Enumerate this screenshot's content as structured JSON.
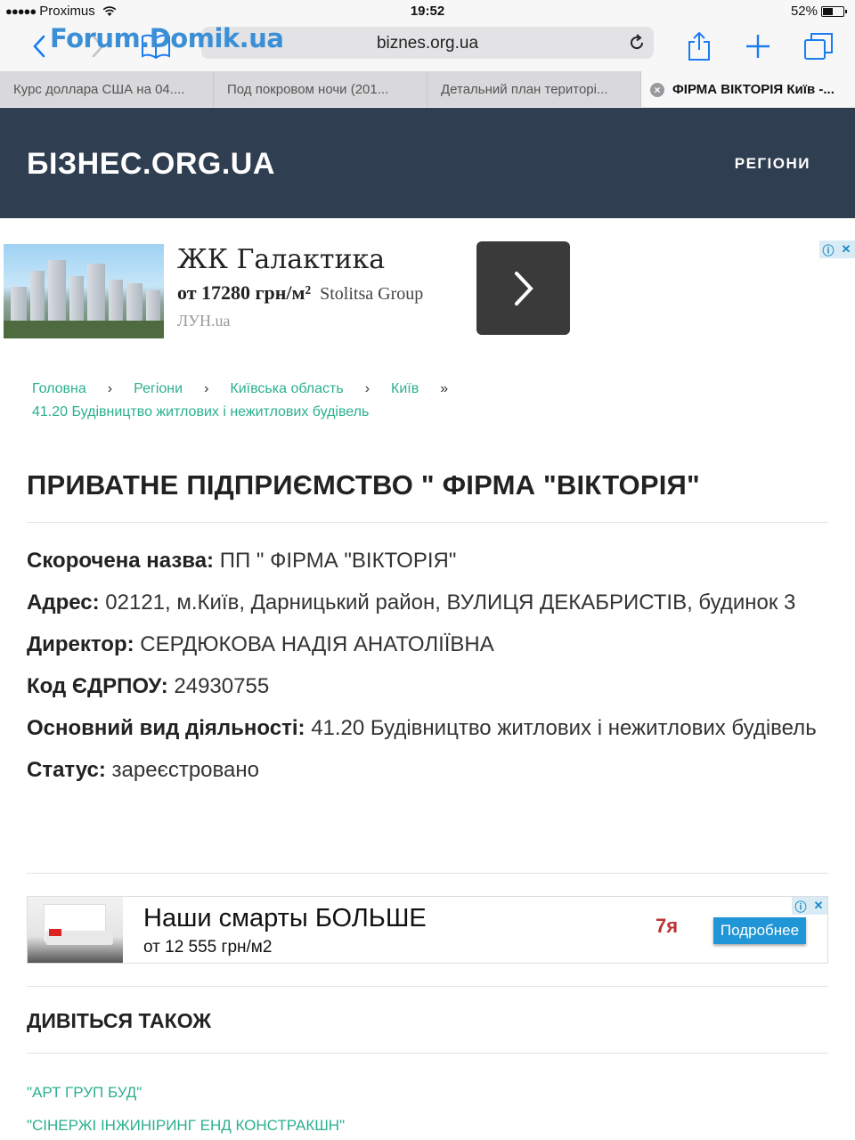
{
  "status_bar": {
    "carrier": "Proximus",
    "time": "19:52",
    "battery": "52%",
    "battery_level": 0.52
  },
  "browser": {
    "url": "biznes.org.ua",
    "watermark": "Forum.Domik.ua",
    "tabs": [
      {
        "title": "Курс доллара США на 04...."
      },
      {
        "title": "Под покровом ночи (201..."
      },
      {
        "title": "Детальний план територі..."
      },
      {
        "title": "ФІРМА ВІКТОРІЯ Київ -..."
      }
    ],
    "active_tab": 3
  },
  "site": {
    "logo": "БІЗНЕС.ORG.UA",
    "nav": "РЕГІОНИ"
  },
  "ad1": {
    "title": "ЖК Галактика",
    "price": "от 17280 грн/м²",
    "brand": "Stolitsa Group",
    "source": "ЛУН.ua"
  },
  "breadcrumb": {
    "items": [
      "Головна",
      "Регіони",
      "Київська область",
      "Київ"
    ],
    "separator": "›",
    "last_separator": "»",
    "current": "41.20 Будівництво житлових і нежитлових будівель"
  },
  "company": {
    "title": "ПРИВАТНЕ ПІДПРИЄМСТВО \" ФІРМА \"ВІКТОРІЯ\"",
    "fields": [
      {
        "label": "Скорочена назва:",
        "value": "ПП \" ФІРМА \"ВІКТОРІЯ\""
      },
      {
        "label": "Адрес:",
        "value": "02121, м.Київ, Дарницький район, ВУЛИЦЯ ДЕКАБРИСТІВ, будинок 3"
      },
      {
        "label": "Директор:",
        "value": "СЕРДЮКОВА НАДІЯ АНАТОЛІЇВНА"
      },
      {
        "label": "Код ЄДРПОУ:",
        "value": "24930755"
      },
      {
        "label": "Основний вид діяльності:",
        "value": "41.20 Будівництво житлових і нежитлових будівель"
      },
      {
        "label": "Статус:",
        "value": "зареєстровано"
      }
    ]
  },
  "ad2": {
    "title": "Наши смарты БОЛЬШЕ",
    "subtitle": "от 12 555 грн/м2",
    "logo": "7я",
    "button": "Подробнее"
  },
  "see_also": {
    "title": "ДИВІТЬСЯ ТАКОЖ",
    "links": [
      "\"АРТ ГРУП БУД\"",
      "\"СІНЕРЖІ ІНЖИНІРИНГ ЕНД КОНСТРАКШН\""
    ]
  },
  "colors": {
    "header_bg": "#2f3e50",
    "link": "#2bb08e",
    "ios_blue": "#1a7cf0",
    "ad_button": "#2196d6"
  }
}
